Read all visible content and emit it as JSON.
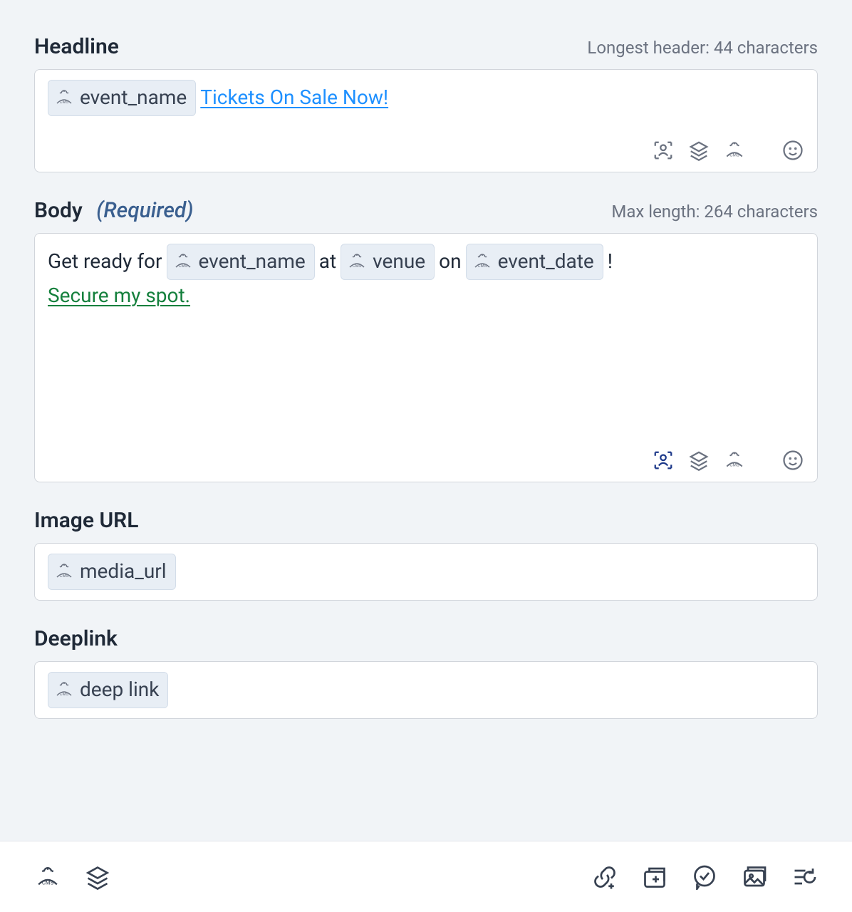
{
  "headline": {
    "label": "Headline",
    "hint": "Longest header: 44 characters",
    "token1": "event_name",
    "link_text": "Tickets On Sale Now!"
  },
  "body": {
    "label": "Body",
    "required": "(Required)",
    "hint": "Max length: 264 characters",
    "text1": "Get ready for",
    "token1": "event_name",
    "text2": "at",
    "token2": "venue",
    "text3": "on",
    "token3": "event_date",
    "text4": "!",
    "link_text": "Secure my spot."
  },
  "image_url": {
    "label": "Image URL",
    "token1": "media_url"
  },
  "deeplink": {
    "label": "Deeplink",
    "token1": "deep link"
  }
}
